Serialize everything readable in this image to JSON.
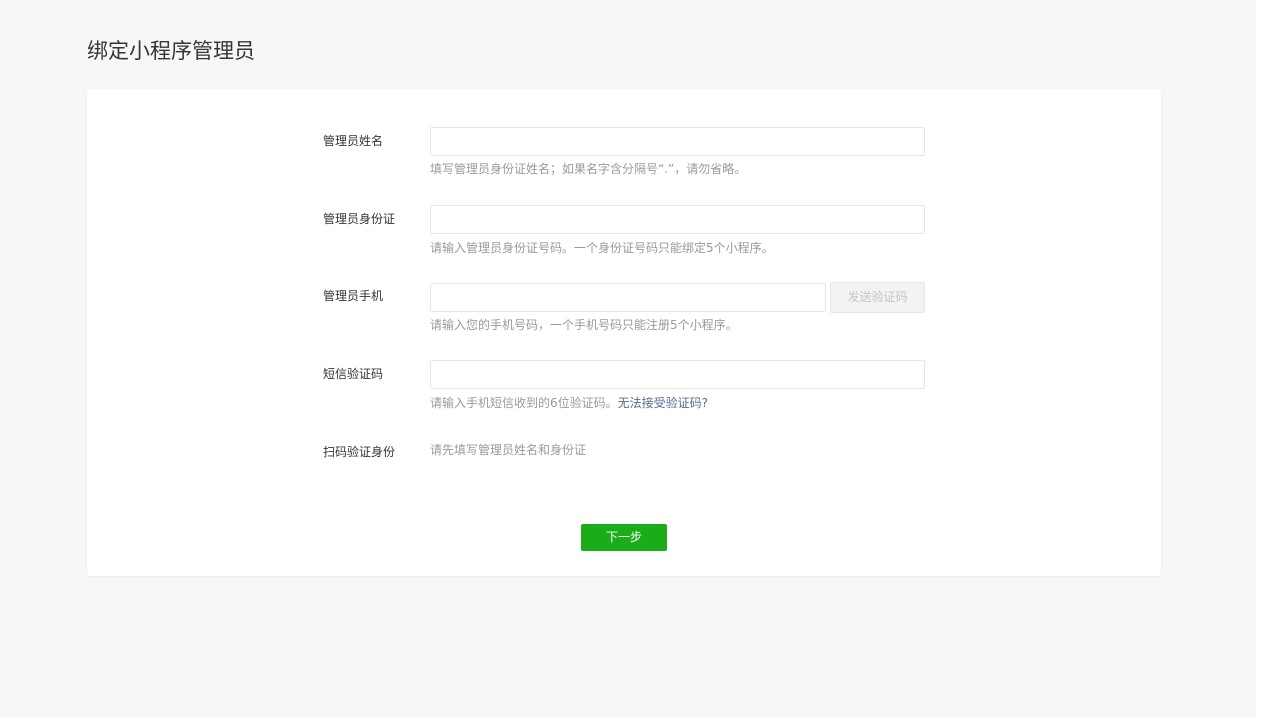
{
  "page": {
    "title": "绑定小程序管理员"
  },
  "form": {
    "name": {
      "label": "管理员姓名",
      "value": "",
      "hint": "填写管理员身份证姓名；如果名字含分隔号“.”，请勿省略。"
    },
    "id_card": {
      "label": "管理员身份证",
      "value": "",
      "hint": "请输入管理员身份证号码。一个身份证号码只能绑定5个小程序。"
    },
    "phone": {
      "label": "管理员手机",
      "value": "",
      "hint": "请输入您的手机号码，一个手机号码只能注册5个小程序。",
      "send_code_label": "发送验证码"
    },
    "sms_code": {
      "label": "短信验证码",
      "value": "",
      "hint": "请输入手机短信收到的6位验证码。",
      "help_link": "无法接受验证码?"
    },
    "scan_verify": {
      "label": "扫码验证身份",
      "hint": "请先填写管理员姓名和身份证"
    }
  },
  "actions": {
    "next_label": "下一步"
  },
  "colors": {
    "page_background": "#f6f7f9",
    "primary_button": "#1aad19",
    "link": "#576b95",
    "hint_text": "#9a9a9a"
  }
}
